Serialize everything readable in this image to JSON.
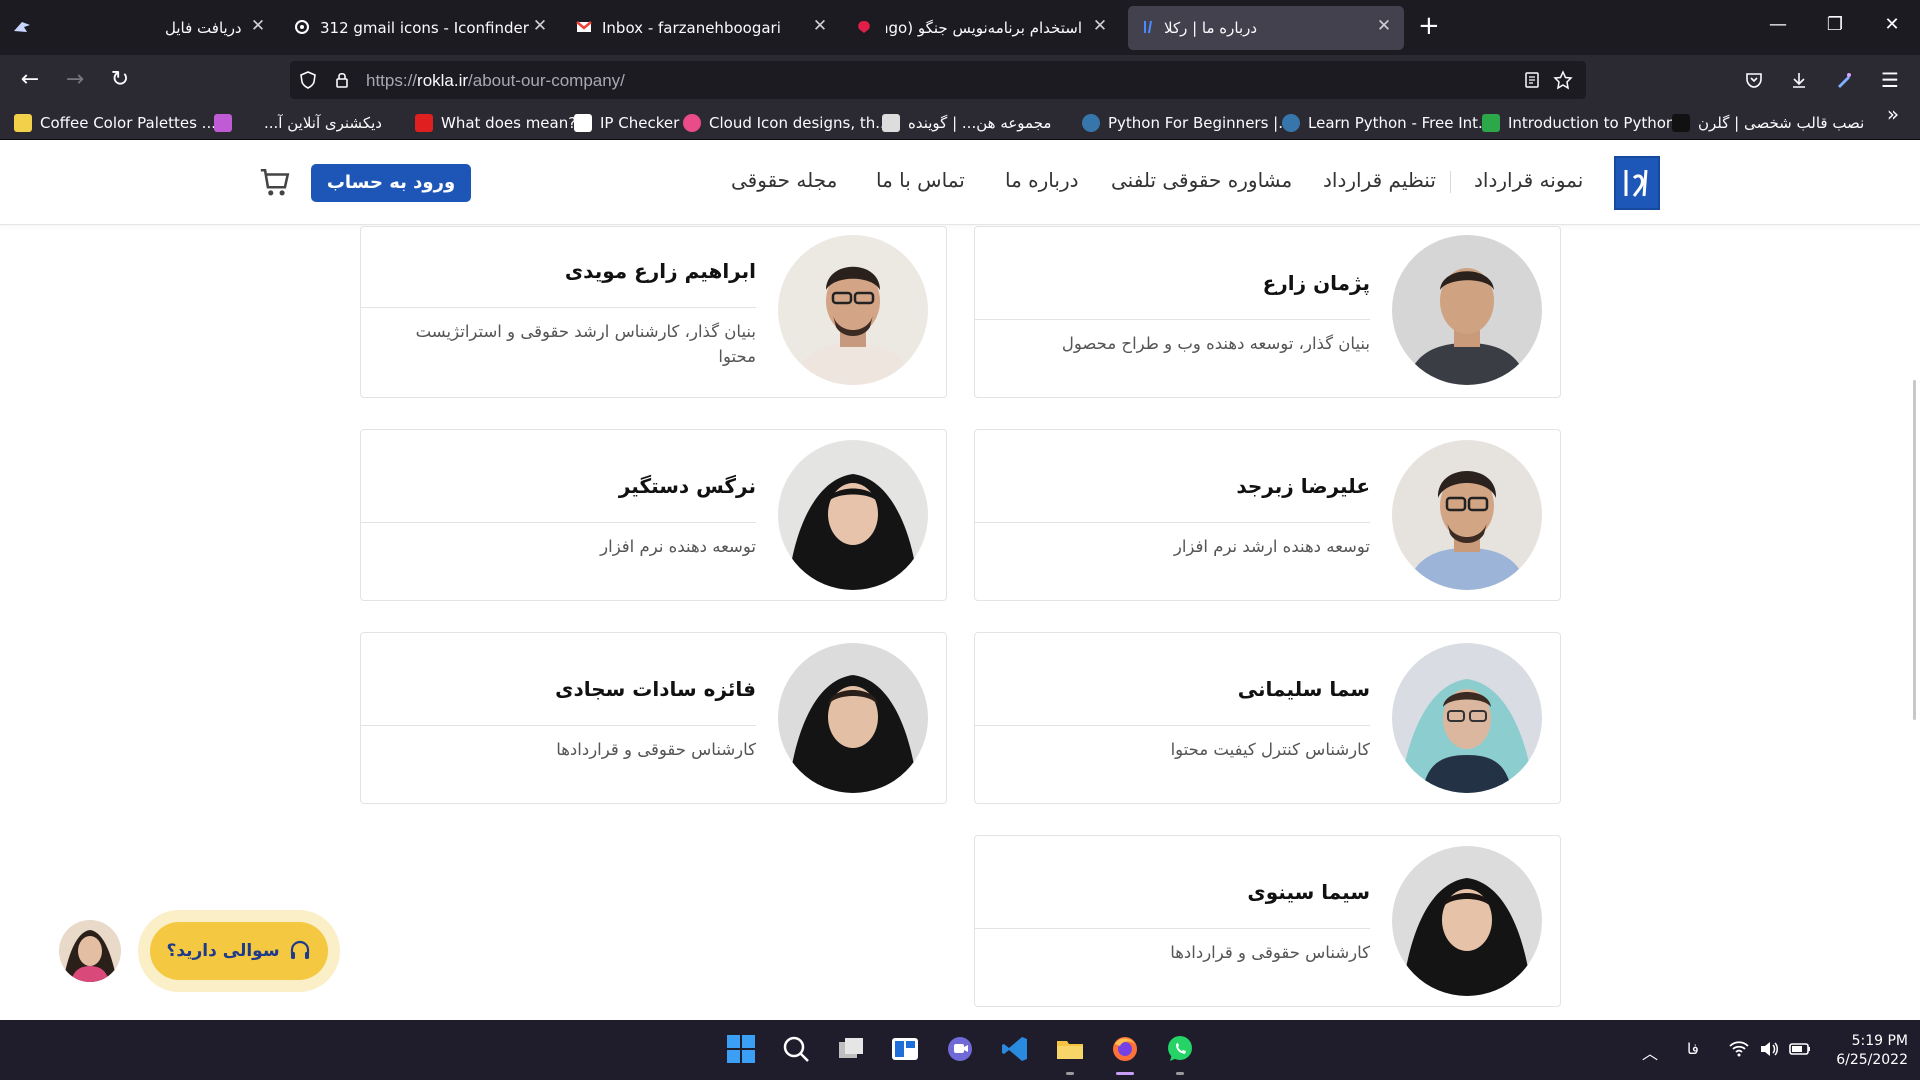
{
  "browser": {
    "tabs": [
      {
        "title": "دریافت فایل",
        "active": false
      },
      {
        "title": "312 gmail icons - Iconfinder",
        "active": false
      },
      {
        "title": "Inbox - farzanehboogari@gmail",
        "active": false
      },
      {
        "title": "استخدام برنامه‌نویس جنگو (ngo",
        "active": false
      },
      {
        "title": "درباره ما | رکلا",
        "active": true
      }
    ],
    "url": {
      "scheme": "https://",
      "host": "rokla.ir",
      "path": "/about-our-company/"
    },
    "bookmarks": [
      {
        "label": "Coffee Color Palettes ...",
        "color": "#f3d04a"
      },
      {
        "label": "",
        "color": "#c05bd6"
      },
      {
        "label": "دیکشنری آنلاین آ...",
        "color": "#2b2a33"
      },
      {
        "label": "What does mean?",
        "color": "#e02020"
      },
      {
        "label": "IP Checker",
        "color": "#ffffff"
      },
      {
        "label": "Cloud Icon designs, th...",
        "color": "#ea4c89"
      },
      {
        "label": "مجموعه هن... | گوینده",
        "color": "#dddddd"
      },
      {
        "label": "Python For Beginners |...",
        "color": "#3776ab"
      },
      {
        "label": "Learn Python - Free Int...",
        "color": "#3776ab"
      },
      {
        "label": "Introduction to Python",
        "color": "#2ca84a"
      },
      {
        "label": "نصب قالب شخصی | گلرن",
        "color": "#111111"
      }
    ]
  },
  "site": {
    "nav": {
      "items": [
        "نمونه قرارداد",
        "تنظیم قرارداد",
        "مشاوره حقوقی تلفنی",
        "درباره ما",
        "تماس با ما",
        "مجله حقوقی"
      ],
      "login": "ورود به حساب"
    },
    "team": [
      {
        "name": "پژمان زارع",
        "role": "بنیان گذار، توسعه دهنده وب و طراح محصول",
        "photo_bg": "#6b6b6b",
        "shirt": "#3a3d44"
      },
      {
        "name": "ابراهیم زارع مویدی",
        "role": "بنیان گذار، کارشناس ارشد حقوقی و استراتژیست محتوا",
        "photo_bg": "#ece8e2",
        "shirt": "#efe5df"
      },
      {
        "name": "علیرضا زبرجد",
        "role": "توسعه دهنده ارشد نرم افزار",
        "photo_bg": "#e6e3de",
        "shirt": "#9bb4d8"
      },
      {
        "name": "نرگس دستگیر",
        "role": "توسعه دهنده نرم افزار",
        "photo_bg": "#e4e4e2",
        "shirt": "#141414"
      },
      {
        "name": "سما سلیمانی",
        "role": "کارشناس کنترل کیفیت محتوا",
        "photo_bg": "#d9dde3",
        "shirt": "#8ccdd0"
      },
      {
        "name": "فائزه سادات سجادی",
        "role": "کارشناس حقوقی و قراردادها",
        "photo_bg": "#dcdcdc",
        "shirt": "#141414"
      },
      {
        "name": "سیما سینوی",
        "role": "کارشناس حقوقی و قراردادها",
        "photo_bg": "#dcdcdc",
        "shirt": "#141414"
      }
    ],
    "chat": {
      "label": "سوالی دارید؟"
    }
  },
  "taskbar": {
    "lang": "فا",
    "time": "5:19 PM",
    "date": "6/25/2022"
  },
  "colors": {
    "brand": "#1e56b8",
    "chat": "#f5c842"
  }
}
